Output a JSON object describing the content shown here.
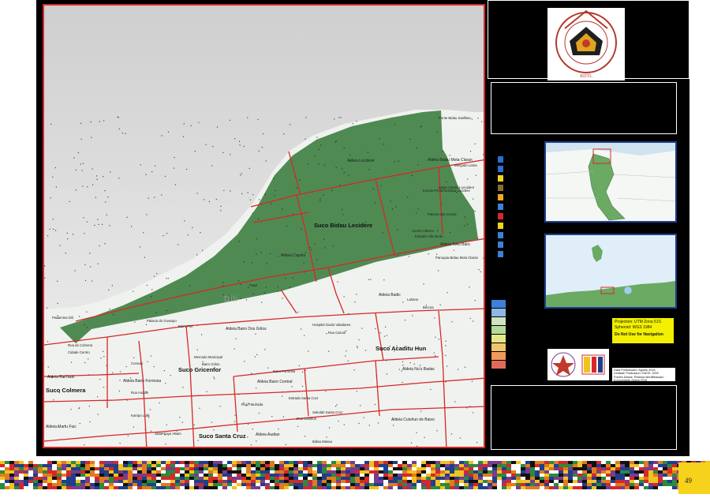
{
  "map": {
    "city_label": "Dili",
    "suco_labels": [
      "Suco Bidau Lecidere",
      "Suco Acaditu Hun",
      "Suco Gricenfor",
      "Suco Colmera",
      "Suco Santa Cruz"
    ],
    "aldeia_labels": [
      "Aldeia Lecidere",
      "Aldeia Bidau Mota Claran",
      "Aldeia Capela",
      "Aldeia Toko Baru",
      "Aldeia Badic",
      "Aldeia Bairo Dos Grilos",
      "Aldeia Nu'u Badac",
      "Aldeia Rai Nain",
      "Aldeia Bairo Formosa",
      "Aldeia Bairo Central",
      "Aldeia Marfu Fuic",
      "Aldeia Audian",
      "Aldeia Culuhun de Baixo"
    ],
    "place_labels": [
      "Ponte Bidau Santana",
      "Escola Primaria Bidau Lecidere",
      "Palacio das Cinzas",
      "Centro Atletico",
      "Paroquia Bidau Mota Claran",
      "Igreja Catolica Lecidere",
      "Mercado Lama",
      "Estrada Vila Verde",
      "Farol",
      "Pertamina Dili",
      "Palacio do Governo",
      "Bairo Pite",
      "Rua de Colmera",
      "Cidade Centro",
      "Comoro",
      "Hospital Guido Valadares",
      "Rua Caicoli",
      "Mercado Municipal",
      "Bairo Grilos",
      "Bairo Formosa",
      "Rua Audian",
      "Sekolah Santa Cruz",
      "Rua Culuhun",
      "Kampo Lulik",
      "Rua Fatuhada",
      "Estrada Santa Cruz",
      "Jalan Kayu Hitam",
      "Bidau Masau",
      "Lahane",
      "Becora"
    ]
  },
  "title_block": {
    "seal_text": "REPUBLICA DEMOCRATICA DE TIMOR-LESTE",
    "seal_initials": "RDTL"
  },
  "info_box": {
    "projection": "Projection: UTM Zona 51S",
    "spheroid": "Spheroid: WGS 1984",
    "warning": "Do Not Use for Navigation",
    "production_lines": [
      "Data Produksaun: Agostu 2016",
      "Unidade Produsaun: GNCE, DGE",
      "Fontes Dadus: Peskisa Identifikasaun",
      "Komunidade Aldeia 2016"
    ]
  },
  "colors": {
    "frame": "#000000",
    "land": "#f0f2ef",
    "suco_fill": "#4f8a52",
    "sea": "#d2d2d2",
    "boundary": "#d62828",
    "inset_water": "#dfeef8",
    "inset_land": "#6aaa63",
    "proj_box": "#f2f000",
    "page_tab": "#f6d21c"
  },
  "legend_icons": [
    "navigation-icon",
    "water-icon",
    "school-icon",
    "church-icon",
    "market-icon",
    "bus-icon",
    "hospital-icon",
    "monument-icon",
    "office-icon",
    "shop-icon",
    "computer-icon"
  ],
  "page_number": "49"
}
